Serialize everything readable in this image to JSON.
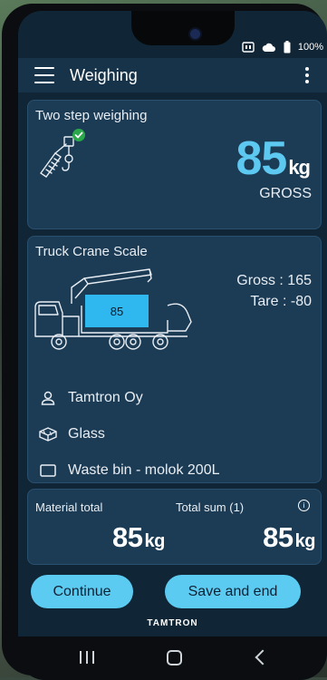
{
  "status": {
    "battery": "100%"
  },
  "appbar": {
    "title": "Weighing"
  },
  "two_step": {
    "title": "Two step weighing",
    "weight": "85",
    "unit": "kg",
    "label": "GROSS"
  },
  "truck_card": {
    "title": "Truck Crane Scale",
    "bin_value": "85",
    "gross": "Gross : 165",
    "tare": "Tare : -80",
    "customer": "Tamtron Oy",
    "material": "Glass",
    "container": "Waste bin - molok 200L"
  },
  "totals": {
    "material_label": "Material total",
    "material_value": "85",
    "sum_label": "Total sum (1)",
    "sum_value": "85",
    "unit": "kg"
  },
  "buttons": {
    "continue": "Continue",
    "save_end": "Save and end"
  },
  "brand": "TAMTRON",
  "colors": {
    "accent": "#5dc8f0",
    "card": "#1c3b55",
    "appbar": "#173349",
    "check": "#2aa84a"
  }
}
